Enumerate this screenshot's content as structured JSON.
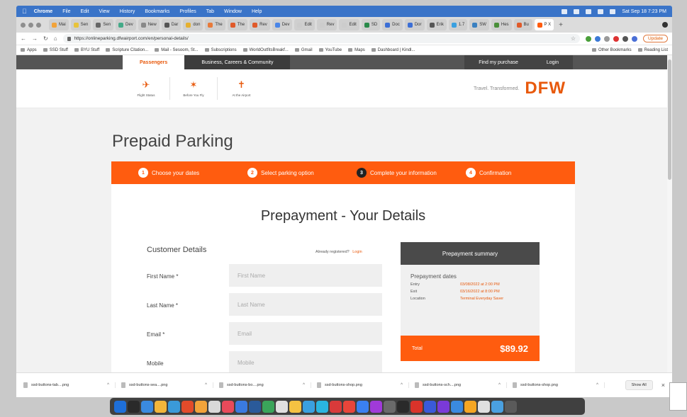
{
  "menubar": {
    "app": "Chrome",
    "items": [
      "File",
      "Edit",
      "View",
      "History",
      "Bookmarks",
      "Profiles",
      "Tab",
      "Window",
      "Help"
    ],
    "clock": "Sat Sep 18 7:23 PM"
  },
  "tabs": [
    {
      "label": "Mai"
    },
    {
      "label": "Sen"
    },
    {
      "label": "Sen"
    },
    {
      "label": "Dev"
    },
    {
      "label": "New"
    },
    {
      "label": "Dar"
    },
    {
      "label": "don"
    },
    {
      "label": "The"
    },
    {
      "label": "The"
    },
    {
      "label": "Rev"
    },
    {
      "label": "Dev"
    },
    {
      "label": "Edit"
    },
    {
      "label": "Rev"
    },
    {
      "label": "Edit"
    },
    {
      "label": "SD"
    },
    {
      "label": "Doc"
    },
    {
      "label": "Dor"
    },
    {
      "label": "Erik"
    },
    {
      "label": "1.7"
    },
    {
      "label": "SW"
    },
    {
      "label": "Hes"
    },
    {
      "label": "Bu"
    },
    {
      "label": "P X"
    }
  ],
  "toolbar": {
    "url": "https://onlineparking.dfwairport.com/en/personal-details/",
    "update_label": "Update"
  },
  "bookmarks": {
    "left": [
      "Apps",
      "SSD Stuff",
      "BYU Stuff",
      "Scripture Citation...",
      "Mail - Sesoom, St...",
      "Subscriptions",
      "WorldOutfitsBreakf...",
      "Gmail",
      "YouTube",
      "Maps",
      "Dashboard | Kindl..."
    ],
    "right": [
      "Other Bookmarks",
      "Reading List"
    ]
  },
  "site_nav": {
    "passengers": "Passengers",
    "business": "Business, Careers & Community",
    "find_purchase": "Find my purchase",
    "login": "Login"
  },
  "quicklinks": [
    {
      "label": "Flight Status",
      "icon": "airplane-icon"
    },
    {
      "label": "Before You Fly",
      "icon": "traveler-icon"
    },
    {
      "label": "At the Airport",
      "icon": "terminal-icon"
    }
  ],
  "brand": {
    "tagline": "Travel. Transformed.",
    "logo": "DFW"
  },
  "page": {
    "title": "Prepaid Parking"
  },
  "steps": [
    {
      "num": "1",
      "label": "Choose your dates"
    },
    {
      "num": "2",
      "label": "Select parking option"
    },
    {
      "num": "3",
      "label": "Complete your information"
    },
    {
      "num": "4",
      "label": "Confirmation"
    }
  ],
  "form": {
    "title": "Prepayment - Your Details",
    "section": "Customer Details",
    "registered": "Already registered?",
    "registered_login": "Login",
    "fields": [
      {
        "label": "First Name *",
        "placeholder": "First Name"
      },
      {
        "label": "Last Name *",
        "placeholder": "Last Name"
      },
      {
        "label": "Email *",
        "placeholder": "Email"
      },
      {
        "label": "Mobile",
        "placeholder": "Mobile"
      }
    ]
  },
  "summary": {
    "header": "Prepayment summary",
    "section": "Prepayment dates",
    "rows": [
      {
        "k": "Entry",
        "v": "03/08/2022 at 2:00 PM"
      },
      {
        "k": "Exit",
        "v": "03/16/2022 at 8:00 PM"
      },
      {
        "k": "Location",
        "v": "Terminal Everyday Saver"
      }
    ],
    "total_label": "Total",
    "total_value": "$89.92"
  },
  "downloads": {
    "items": [
      "ssd-buttons-tab....png",
      "ssd-buttons-sea....png",
      "ssd-buttons-bo....png",
      "ssd-buttons-shop.png",
      "ssd-buttons-sch....png",
      "ssd-buttons-shop.png"
    ],
    "show_all": "Show All"
  }
}
